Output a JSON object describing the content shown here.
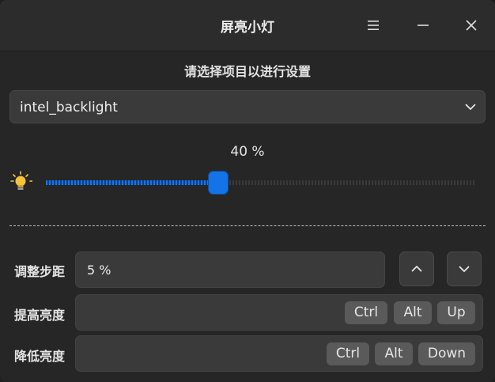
{
  "window": {
    "title": "屏亮小灯",
    "menu_icon": "hamburger-menu-icon",
    "minimize_icon": "minimize-icon",
    "close_icon": "close-icon"
  },
  "device": {
    "prompt": "请选择项目以进行设置",
    "selected": "intel_backlight"
  },
  "brightness": {
    "label": "40 %",
    "level_percent": 40,
    "icon": "lightbulb-icon"
  },
  "settings": {
    "step_label": "调整步距",
    "step_value": "5 %",
    "increase_label": "提高亮度",
    "increase_keys": [
      "Ctrl",
      "Alt",
      "Up"
    ],
    "decrease_label": "降低亮度",
    "decrease_keys": [
      "Ctrl",
      "Alt",
      "Down"
    ]
  },
  "colors": {
    "accent": "#1473e6",
    "background": "#262626",
    "field": "#3a3a3a",
    "keycap": "#5a5a5a"
  }
}
